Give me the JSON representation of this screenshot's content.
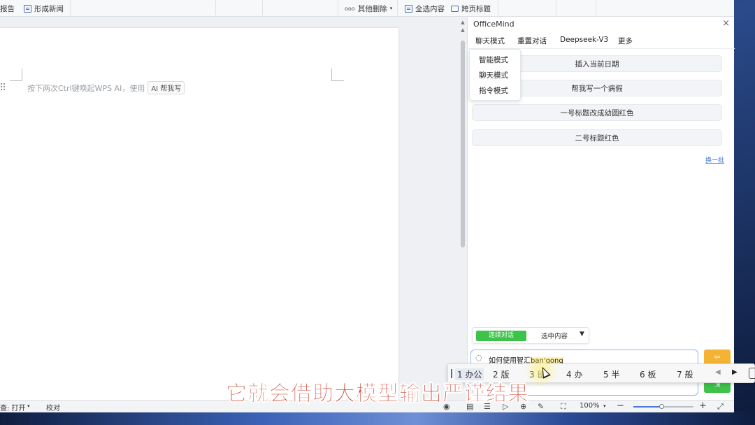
{
  "ribbon": {
    "report_label": "报告",
    "news_label": "形成新闻",
    "other_delete_label": "其他删除",
    "select_all_label": "全选内容",
    "cross_page_label": "跨页标题"
  },
  "document": {
    "hint_text": "按下两次Ctrl键唤起WPS AI，使用",
    "ai_chip": "AI 帮我写"
  },
  "status": {
    "spellcheck": "查: 打开",
    "proofread": "校对",
    "zoom": "100%",
    "zoom_level": 0.48
  },
  "panel": {
    "title": "OfficeMind",
    "tabs": [
      "聊天模式",
      "重置对话",
      "Deepseek-V3",
      "更多"
    ],
    "modes": [
      "智能模式",
      "聊天模式",
      "指令模式"
    ],
    "suggestions": [
      "插入当前日期",
      "帮我写一个病假",
      "一号标题改成幼圆红色",
      "二号标题红色"
    ],
    "refresh": "换一批",
    "context_left": "连续对话",
    "context_select": "选中内容",
    "input_text": "如何使用智汇",
    "input_composition": "ban'gong"
  },
  "ime": {
    "candidates": [
      "1 办公",
      "2 版",
      "3 班",
      "4 办",
      "5 半",
      "6 板",
      "7 般"
    ]
  },
  "subtitle": "它就会借助大模型输出严谨结果",
  "colors": {
    "accent_green": "#3ec34a",
    "send_orange": "#f5b335",
    "subtitle_red": "#c93a2a"
  },
  "icons": [
    "doc-icon",
    "dots-icon",
    "chevron-down-icon",
    "select-all-icon",
    "cross-page-icon",
    "close-icon",
    "chat-bubble-icon",
    "send-icon",
    "eye-icon",
    "layout-icon",
    "list-icon",
    "play-icon",
    "globe-icon",
    "pen-icon",
    "fit-icon",
    "zoom-out-icon",
    "zoom-in-icon",
    "fullscreen-icon"
  ]
}
